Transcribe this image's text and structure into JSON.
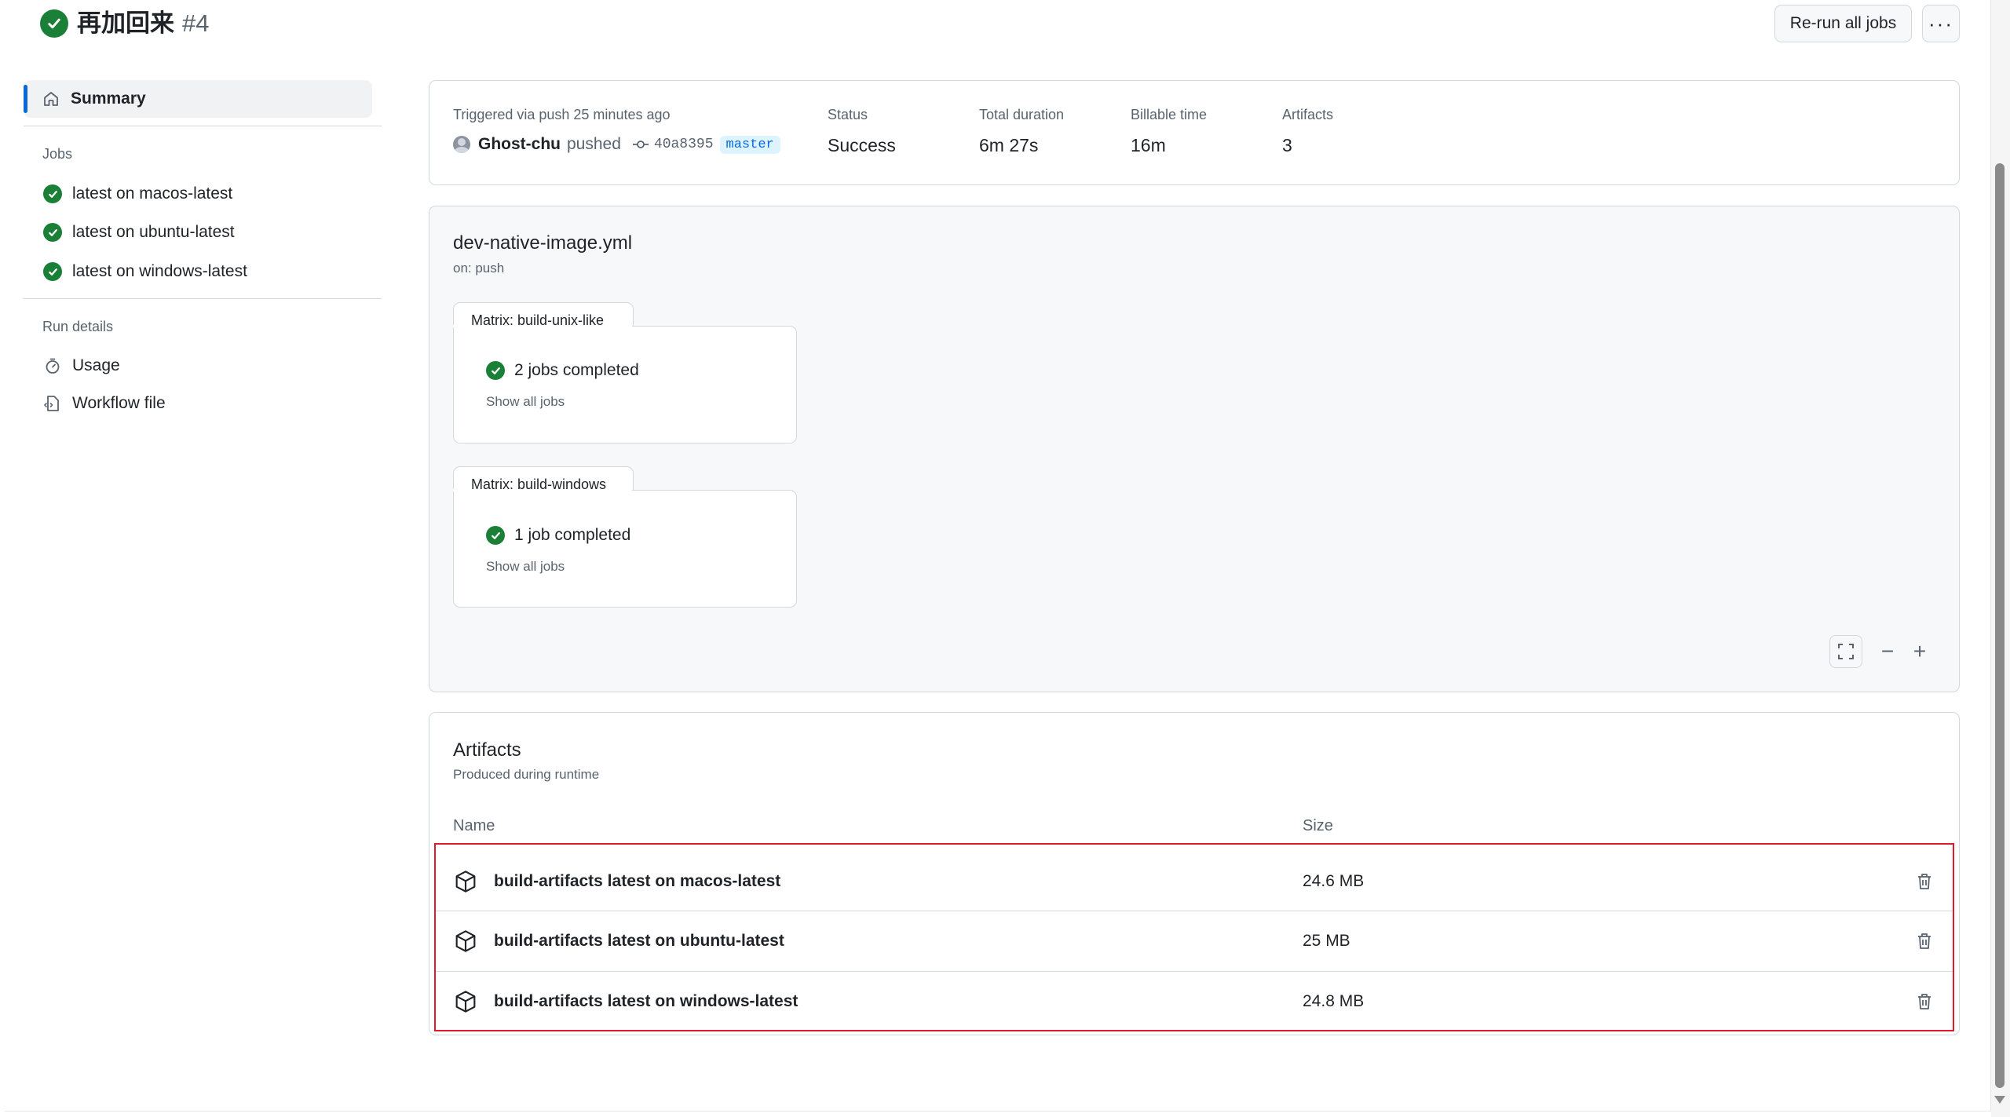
{
  "header": {
    "title": "再加回来",
    "run_number": "#4",
    "rerun_label": "Re-run all jobs",
    "more_label": "···"
  },
  "sidebar": {
    "summary_label": "Summary",
    "jobs_heading": "Jobs",
    "jobs": [
      {
        "label": "latest on macos-latest"
      },
      {
        "label": "latest on ubuntu-latest"
      },
      {
        "label": "latest on windows-latest"
      }
    ],
    "run_details_heading": "Run details",
    "usage_label": "Usage",
    "workflow_file_label": "Workflow file"
  },
  "summary": {
    "triggered_label": "Triggered via push 25 minutes ago",
    "actor": "Ghost-chu",
    "action": "pushed",
    "commit": "40a8395",
    "branch": "master",
    "status_label": "Status",
    "status_value": "Success",
    "duration_label": "Total duration",
    "duration_value": "6m 27s",
    "billable_label": "Billable time",
    "billable_value": "16m",
    "artifacts_label": "Artifacts",
    "artifacts_value": "3"
  },
  "workflow": {
    "file": "dev-native-image.yml",
    "trigger": "on: push",
    "matrices": [
      {
        "tab": "Matrix: build-unix-like",
        "status": "2 jobs completed",
        "link": "Show all jobs"
      },
      {
        "tab": "Matrix: build-windows",
        "status": "1 job completed",
        "link": "Show all jobs"
      }
    ],
    "zoom_out": "−",
    "zoom_in": "+"
  },
  "artifacts": {
    "title": "Artifacts",
    "subtitle": "Produced during runtime",
    "col_name": "Name",
    "col_size": "Size",
    "rows": [
      {
        "name": "build-artifacts latest on macos-latest",
        "size": "24.6 MB"
      },
      {
        "name": "build-artifacts latest on ubuntu-latest",
        "size": "25 MB"
      },
      {
        "name": "build-artifacts latest on windows-latest",
        "size": "24.8 MB"
      }
    ]
  },
  "colors": {
    "success": "#1a7f37",
    "accent": "#0969da",
    "highlight": "#e0192b"
  }
}
